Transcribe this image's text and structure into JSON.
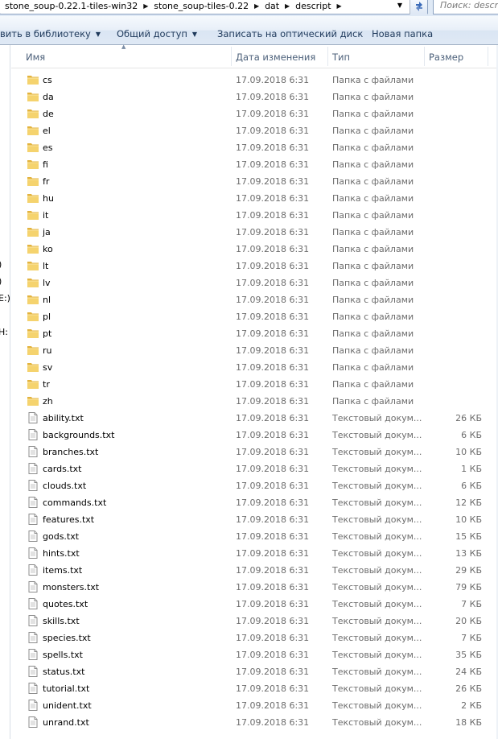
{
  "address_bar": {
    "crumbs": [
      "stone_soup-0.22.1-tiles-win32",
      "stone_soup-tiles-0.22",
      "dat",
      "descript"
    ],
    "search_placeholder": "Поиск: descript"
  },
  "toolbar": {
    "add_to_library": "вить в библиотеку",
    "share": "Общий доступ",
    "burn": "Записать на оптический диск",
    "new_folder": "Новая папка"
  },
  "nav_fragments": [
    ")",
    ")",
    "E:)",
    "H:"
  ],
  "columns": {
    "name": "Имя",
    "date": "Дата изменения",
    "type": "Тип",
    "size": "Размер"
  },
  "files": [
    {
      "name": "cs",
      "date": "17.09.2018 6:31",
      "type": "Папка с файлами",
      "size": "",
      "icon": "folder-icon"
    },
    {
      "name": "da",
      "date": "17.09.2018 6:31",
      "type": "Папка с файлами",
      "size": "",
      "icon": "folder-icon"
    },
    {
      "name": "de",
      "date": "17.09.2018 6:31",
      "type": "Папка с файлами",
      "size": "",
      "icon": "folder-icon"
    },
    {
      "name": "el",
      "date": "17.09.2018 6:31",
      "type": "Папка с файлами",
      "size": "",
      "icon": "folder-icon"
    },
    {
      "name": "es",
      "date": "17.09.2018 6:31",
      "type": "Папка с файлами",
      "size": "",
      "icon": "folder-icon"
    },
    {
      "name": "fi",
      "date": "17.09.2018 6:31",
      "type": "Папка с файлами",
      "size": "",
      "icon": "folder-icon"
    },
    {
      "name": "fr",
      "date": "17.09.2018 6:31",
      "type": "Папка с файлами",
      "size": "",
      "icon": "folder-icon"
    },
    {
      "name": "hu",
      "date": "17.09.2018 6:31",
      "type": "Папка с файлами",
      "size": "",
      "icon": "folder-icon"
    },
    {
      "name": "it",
      "date": "17.09.2018 6:31",
      "type": "Папка с файлами",
      "size": "",
      "icon": "folder-icon"
    },
    {
      "name": "ja",
      "date": "17.09.2018 6:31",
      "type": "Папка с файлами",
      "size": "",
      "icon": "folder-icon"
    },
    {
      "name": "ko",
      "date": "17.09.2018 6:31",
      "type": "Папка с файлами",
      "size": "",
      "icon": "folder-icon"
    },
    {
      "name": "lt",
      "date": "17.09.2018 6:31",
      "type": "Папка с файлами",
      "size": "",
      "icon": "folder-icon"
    },
    {
      "name": "lv",
      "date": "17.09.2018 6:31",
      "type": "Папка с файлами",
      "size": "",
      "icon": "folder-icon"
    },
    {
      "name": "nl",
      "date": "17.09.2018 6:31",
      "type": "Папка с файлами",
      "size": "",
      "icon": "folder-icon"
    },
    {
      "name": "pl",
      "date": "17.09.2018 6:31",
      "type": "Папка с файлами",
      "size": "",
      "icon": "folder-icon"
    },
    {
      "name": "pt",
      "date": "17.09.2018 6:31",
      "type": "Папка с файлами",
      "size": "",
      "icon": "folder-icon"
    },
    {
      "name": "ru",
      "date": "17.09.2018 6:31",
      "type": "Папка с файлами",
      "size": "",
      "icon": "folder-icon"
    },
    {
      "name": "sv",
      "date": "17.09.2018 6:31",
      "type": "Папка с файлами",
      "size": "",
      "icon": "folder-icon"
    },
    {
      "name": "tr",
      "date": "17.09.2018 6:31",
      "type": "Папка с файлами",
      "size": "",
      "icon": "folder-icon"
    },
    {
      "name": "zh",
      "date": "17.09.2018 6:31",
      "type": "Папка с файлами",
      "size": "",
      "icon": "folder-icon"
    },
    {
      "name": "ability.txt",
      "date": "17.09.2018 6:31",
      "type": "Текстовый докум...",
      "size": "26 КБ",
      "icon": "text-file-icon"
    },
    {
      "name": "backgrounds.txt",
      "date": "17.09.2018 6:31",
      "type": "Текстовый докум...",
      "size": "6 КБ",
      "icon": "text-file-icon"
    },
    {
      "name": "branches.txt",
      "date": "17.09.2018 6:31",
      "type": "Текстовый докум...",
      "size": "10 КБ",
      "icon": "text-file-icon"
    },
    {
      "name": "cards.txt",
      "date": "17.09.2018 6:31",
      "type": "Текстовый докум...",
      "size": "1 КБ",
      "icon": "text-file-icon"
    },
    {
      "name": "clouds.txt",
      "date": "17.09.2018 6:31",
      "type": "Текстовый докум...",
      "size": "6 КБ",
      "icon": "text-file-icon"
    },
    {
      "name": "commands.txt",
      "date": "17.09.2018 6:31",
      "type": "Текстовый докум...",
      "size": "12 КБ",
      "icon": "text-file-icon"
    },
    {
      "name": "features.txt",
      "date": "17.09.2018 6:31",
      "type": "Текстовый докум...",
      "size": "10 КБ",
      "icon": "text-file-icon"
    },
    {
      "name": "gods.txt",
      "date": "17.09.2018 6:31",
      "type": "Текстовый докум...",
      "size": "15 КБ",
      "icon": "text-file-icon"
    },
    {
      "name": "hints.txt",
      "date": "17.09.2018 6:31",
      "type": "Текстовый докум...",
      "size": "13 КБ",
      "icon": "text-file-icon"
    },
    {
      "name": "items.txt",
      "date": "17.09.2018 6:31",
      "type": "Текстовый докум...",
      "size": "29 КБ",
      "icon": "text-file-icon"
    },
    {
      "name": "monsters.txt",
      "date": "17.09.2018 6:31",
      "type": "Текстовый докум...",
      "size": "79 КБ",
      "icon": "text-file-icon"
    },
    {
      "name": "quotes.txt",
      "date": "17.09.2018 6:31",
      "type": "Текстовый докум...",
      "size": "7 КБ",
      "icon": "text-file-icon"
    },
    {
      "name": "skills.txt",
      "date": "17.09.2018 6:31",
      "type": "Текстовый докум...",
      "size": "20 КБ",
      "icon": "text-file-icon"
    },
    {
      "name": "species.txt",
      "date": "17.09.2018 6:31",
      "type": "Текстовый докум...",
      "size": "7 КБ",
      "icon": "text-file-icon"
    },
    {
      "name": "spells.txt",
      "date": "17.09.2018 6:31",
      "type": "Текстовый докум...",
      "size": "35 КБ",
      "icon": "text-file-icon"
    },
    {
      "name": "status.txt",
      "date": "17.09.2018 6:31",
      "type": "Текстовый докум...",
      "size": "24 КБ",
      "icon": "text-file-icon"
    },
    {
      "name": "tutorial.txt",
      "date": "17.09.2018 6:31",
      "type": "Текстовый докум...",
      "size": "26 КБ",
      "icon": "text-file-icon"
    },
    {
      "name": "unident.txt",
      "date": "17.09.2018 6:31",
      "type": "Текстовый докум...",
      "size": "2 КБ",
      "icon": "text-file-icon"
    },
    {
      "name": "unrand.txt",
      "date": "17.09.2018 6:31",
      "type": "Текстовый докум...",
      "size": "18 КБ",
      "icon": "text-file-icon"
    }
  ],
  "colors": {
    "toolbar_text": "#1e395b",
    "header_text": "#4c607a",
    "secondary_text": "#6d6d6d",
    "folder_yellow": "#f0c650"
  }
}
